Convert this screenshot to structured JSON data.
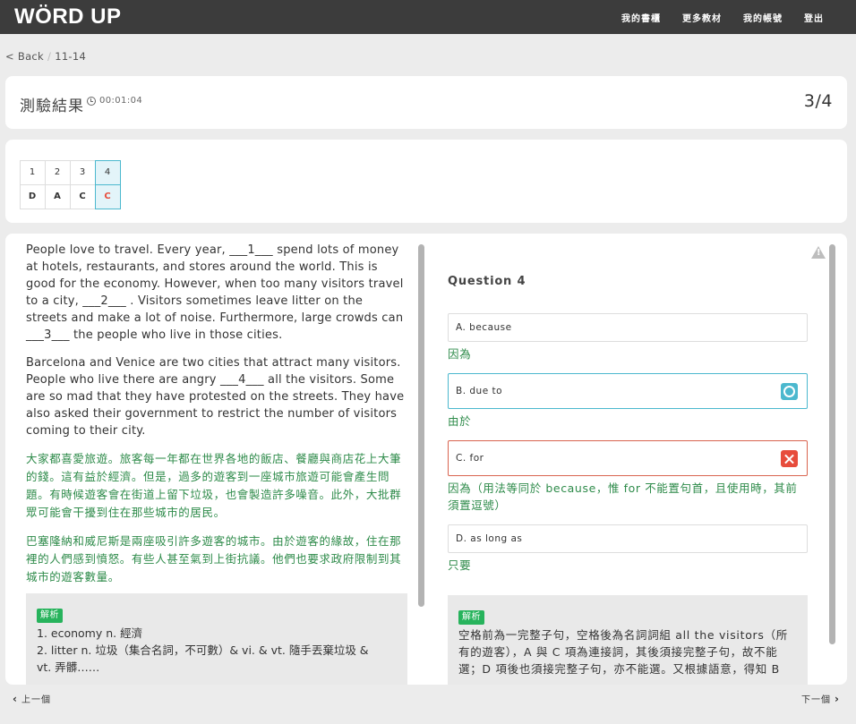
{
  "app": {
    "logo": "WÖRD UP"
  },
  "nav": {
    "bookshelf": "我的書櫃",
    "more_materials": "更多教材",
    "account": "我的帳號",
    "logout": "登出"
  },
  "breadcrumb": {
    "back": "< Back",
    "separator": "/",
    "current": "11-14"
  },
  "header": {
    "title": "測驗結果",
    "timer": "00:01:04",
    "progress": "3/4"
  },
  "answer_grid": {
    "numbers": [
      "1",
      "2",
      "3",
      "4"
    ],
    "answers": [
      "D",
      "A",
      "C",
      "C"
    ],
    "current_index": 4,
    "wrong_color": "#e74c3c",
    "current_bg": "#e3f4f9"
  },
  "passage": {
    "en": [
      "People love to travel. Every year, ___1___ spend lots of money at hotels, restaurants, and stores around the world. This is good for the economy. However, when too many visitors travel to a city, ___2___ . Visitors sometimes leave litter on the streets and make a lot of noise. Furthermore, large crowds can ___3___ the people who live in those cities.",
      "Barcelona and Venice are two cities that attract many visitors. People who live there are angry ___4___ all the visitors. Some are so mad that they have protested on the streets. They have also asked their government to restrict the number of visitors coming to their city."
    ],
    "zh": [
      "大家都喜愛旅遊。旅客每一年都在世界各地的飯店、餐廳與商店花上大筆的錢。這有益於經濟。但是，過多的遊客到一座城市旅遊可能會產生問題。有時候遊客會在街道上留下垃圾，也會製造許多噪音。此外，大批群眾可能會干擾到住在那些城市的居民。",
      "巴塞隆納和威尼斯是兩座吸引許多遊客的城市。由於遊客的緣故，住在那裡的人們感到憤怒。有些人甚至氣到上街抗議。他們也要求政府限制到其城市的遊客數量。"
    ],
    "explanation": {
      "tag": "解析",
      "lines": [
        "1. economy n. 經濟",
        "2. litter n. 垃圾（集合名詞，不可數）& vi. & vt. 隨手丟棄垃圾 &",
        "vt. 弄髒……"
      ]
    }
  },
  "question": {
    "title": "Question 4",
    "options": [
      {
        "label": "A. because",
        "translation": "因為",
        "state": "none"
      },
      {
        "label": "B. due to",
        "translation": "由於",
        "state": "correct"
      },
      {
        "label": "C. for",
        "translation": "因為（用法等同於 because，惟 for 不能置句首，且使用時，其前須置逗號）",
        "state": "wrong"
      },
      {
        "label": "D. as long as",
        "translation": "只要",
        "state": "none"
      }
    ],
    "explanation": {
      "tag": "解析",
      "lines": [
        "空格前為一完整子句，空格後為名詞詞組 all the visitors（所有的遊客），A 與 C 項為連接詞，其後須接完整子句，故不能選；D 項後也須接完整子句，亦不能選。又根據語意，得知 B"
      ]
    },
    "correct_color": "#4bb8ce",
    "wrong_color": "#e74c3c",
    "translation_color": "#2e8b4a"
  },
  "footer": {
    "prev": "上一個",
    "next": "下一個"
  }
}
